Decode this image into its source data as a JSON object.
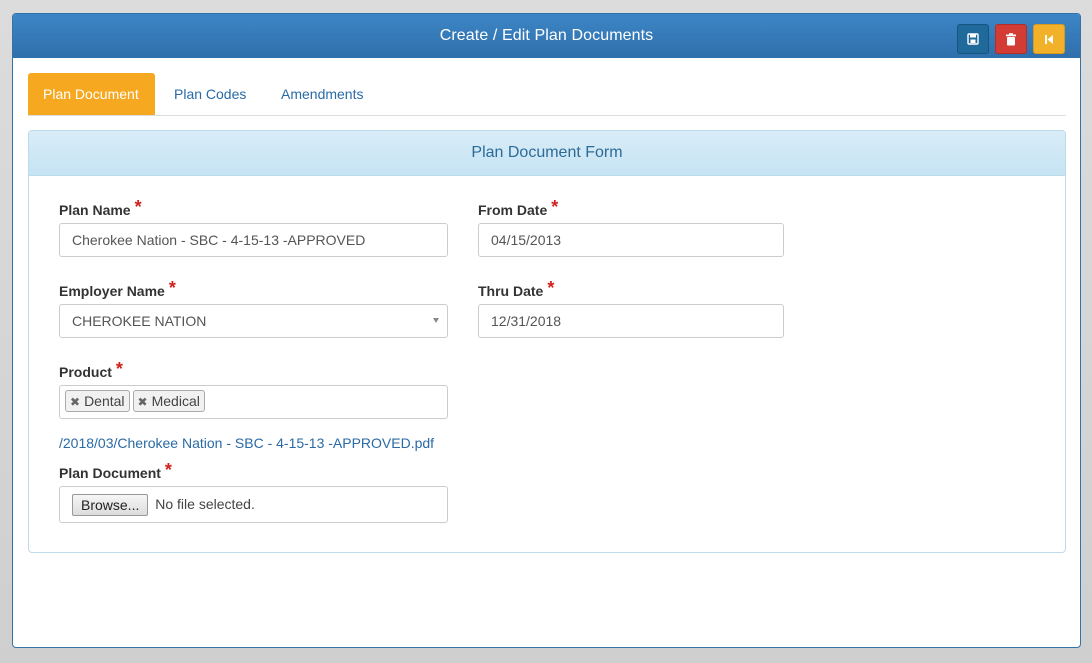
{
  "window": {
    "title": "Create / Edit Plan Documents",
    "buttons": {
      "save": "save-icon",
      "delete": "trash-icon",
      "back": "back-icon"
    }
  },
  "tabs": [
    {
      "label": "Plan Document",
      "active": true
    },
    {
      "label": "Plan Codes",
      "active": false
    },
    {
      "label": "Amendments",
      "active": false
    }
  ],
  "form": {
    "heading": "Plan Document Form",
    "required_mark": "*",
    "plan_name": {
      "label": "Plan Name",
      "value": "Cherokee Nation - SBC  -  4-15-13 -APPROVED"
    },
    "from_date": {
      "label": "From Date",
      "value": "04/15/2013"
    },
    "employer_name": {
      "label": "Employer Name",
      "value": "CHEROKEE NATION"
    },
    "thru_date": {
      "label": "Thru Date",
      "value": "12/31/2018"
    },
    "product": {
      "label": "Product",
      "tags": [
        "Dental",
        "Medical"
      ]
    },
    "file_link": "/2018/03/Cherokee Nation - SBC - 4-15-13 -APPROVED.pdf",
    "plan_document": {
      "label": "Plan Document",
      "browse_label": "Browse...",
      "status": "No file selected."
    }
  },
  "colors": {
    "titlebar": "#2f6fab",
    "active_tab": "#f6a821",
    "save_button": "#1f6a9b",
    "delete_button": "#d33b35",
    "back_button": "#f3b12a",
    "required": "#d0201a",
    "link": "#2a6aa5"
  }
}
